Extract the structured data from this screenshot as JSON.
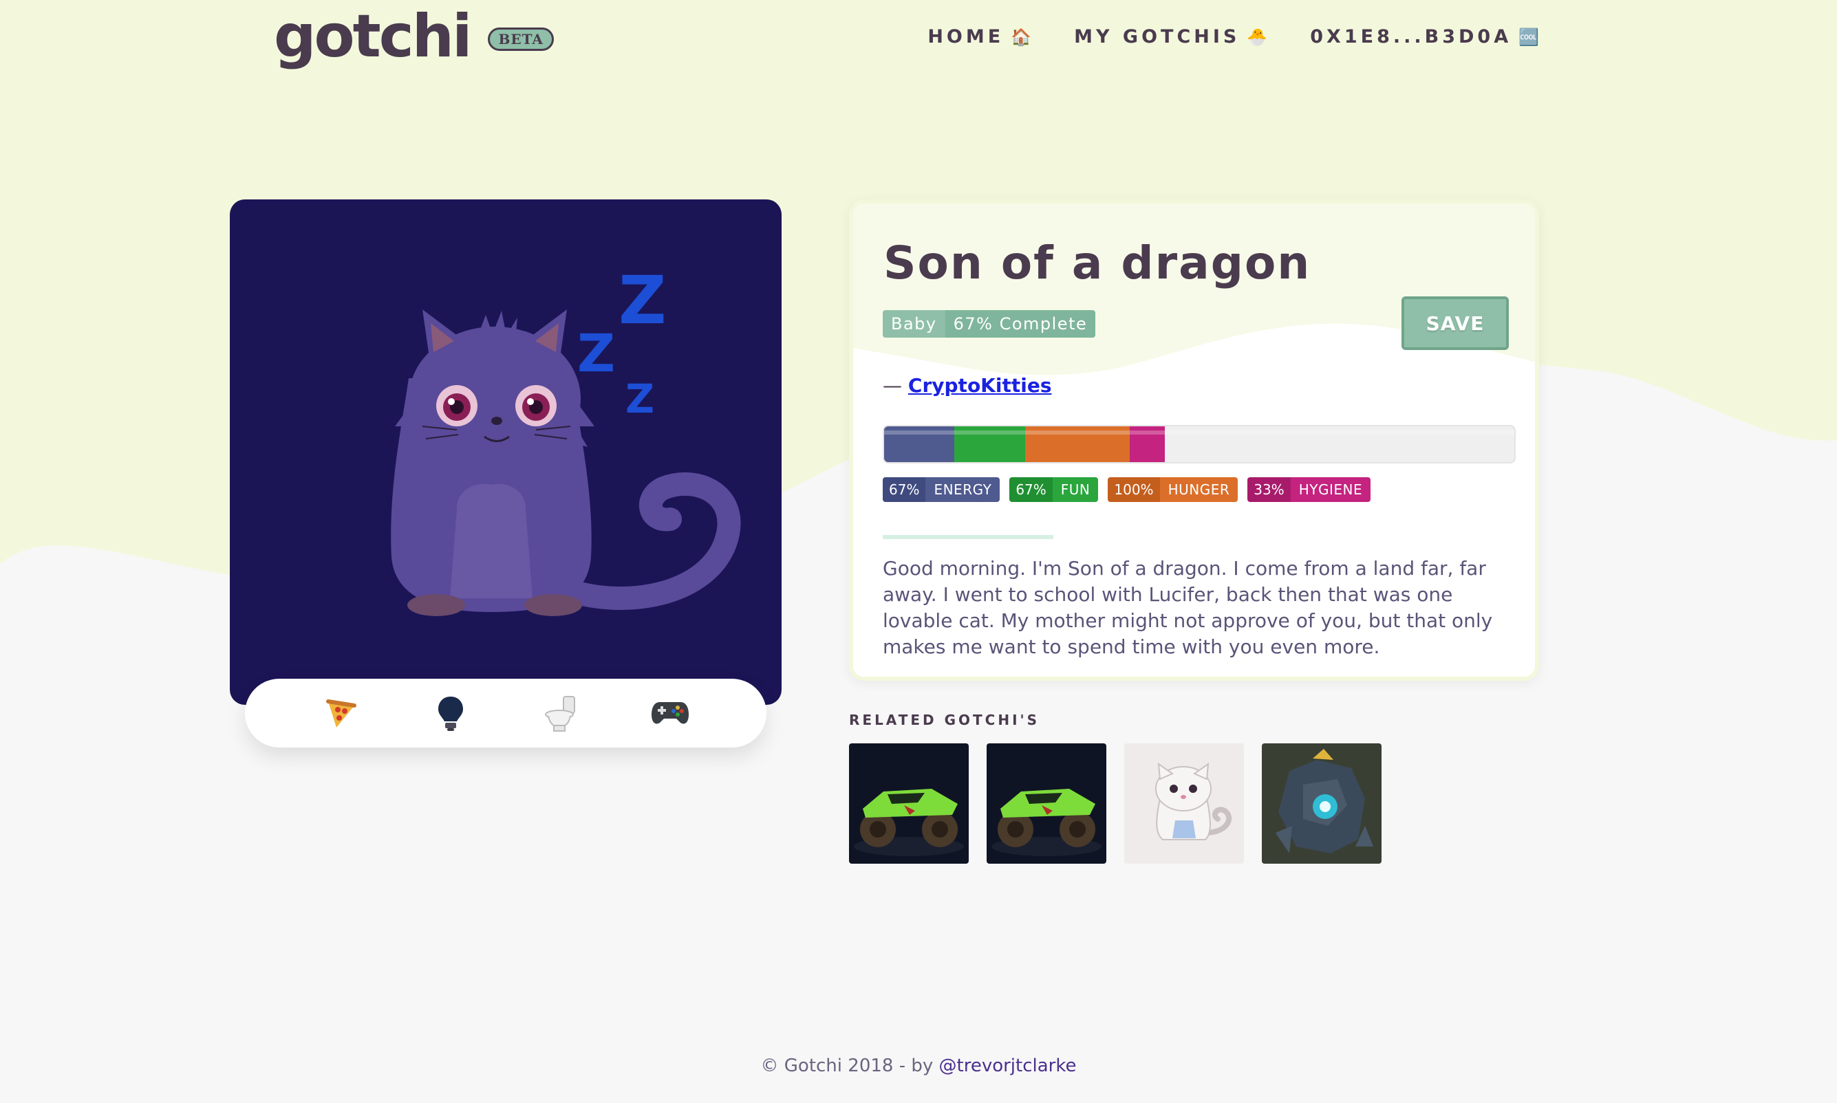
{
  "header": {
    "logo_text": "gotchi",
    "beta_label": "BETA",
    "nav": [
      {
        "label": "HOME",
        "emoji": "🏠"
      },
      {
        "label": "MY GOTCHIS",
        "emoji": "🐣"
      },
      {
        "label": "0X1E8...B3D0A",
        "emoji": "🆒"
      }
    ]
  },
  "pet": {
    "name": "Son of a dragon",
    "stage": "Baby",
    "progress": "67% Complete",
    "save_label": "SAVE",
    "source_prefix": "— ",
    "source_name": "CryptoKitties",
    "sleep_glyph": "Z",
    "stats": [
      {
        "percent_label": "67%",
        "name": "ENERGY",
        "fraction": 0.67,
        "color": "#4f5a8f",
        "dark": "#3f4a7f"
      },
      {
        "percent_label": "67%",
        "name": "FUN",
        "fraction": 0.67,
        "color": "#2aa63d",
        "dark": "#1f8f31"
      },
      {
        "percent_label": "100%",
        "name": "HUNGER",
        "fraction": 1.0,
        "color": "#db6f2a",
        "dark": "#c45e1d"
      },
      {
        "percent_label": "33%",
        "name": "HYGIENE",
        "fraction": 0.33,
        "color": "#c4237f",
        "dark": "#a81b6b"
      }
    ],
    "bio": "Good morning. I'm Son of a dragon. I come from a land far, far away. I went to school with Lucifer, back then that was one lovable cat. My mother might not approve of you, but that only makes me want to spend time with you even more."
  },
  "actions": [
    {
      "icon": "pizza-icon"
    },
    {
      "icon": "lightbulb-icon"
    },
    {
      "icon": "toilet-icon"
    },
    {
      "icon": "gamepad-icon"
    }
  ],
  "related": {
    "title": "RELATED GOTCHI'S",
    "items": [
      {
        "icon": "monster-truck-icon"
      },
      {
        "icon": "monster-truck-icon"
      },
      {
        "icon": "white-kitty-icon"
      },
      {
        "icon": "robot-golem-icon"
      }
    ]
  },
  "footer": {
    "text": "© Gotchi 2018 - by ",
    "author": "@trevorjtclarke"
  },
  "colors": {
    "background": "#f7f7f7",
    "wave": "#f3f8dc",
    "pet_card": "#1b1556",
    "accent_green": "#8fbfa8",
    "text": "#4a3b4e"
  }
}
